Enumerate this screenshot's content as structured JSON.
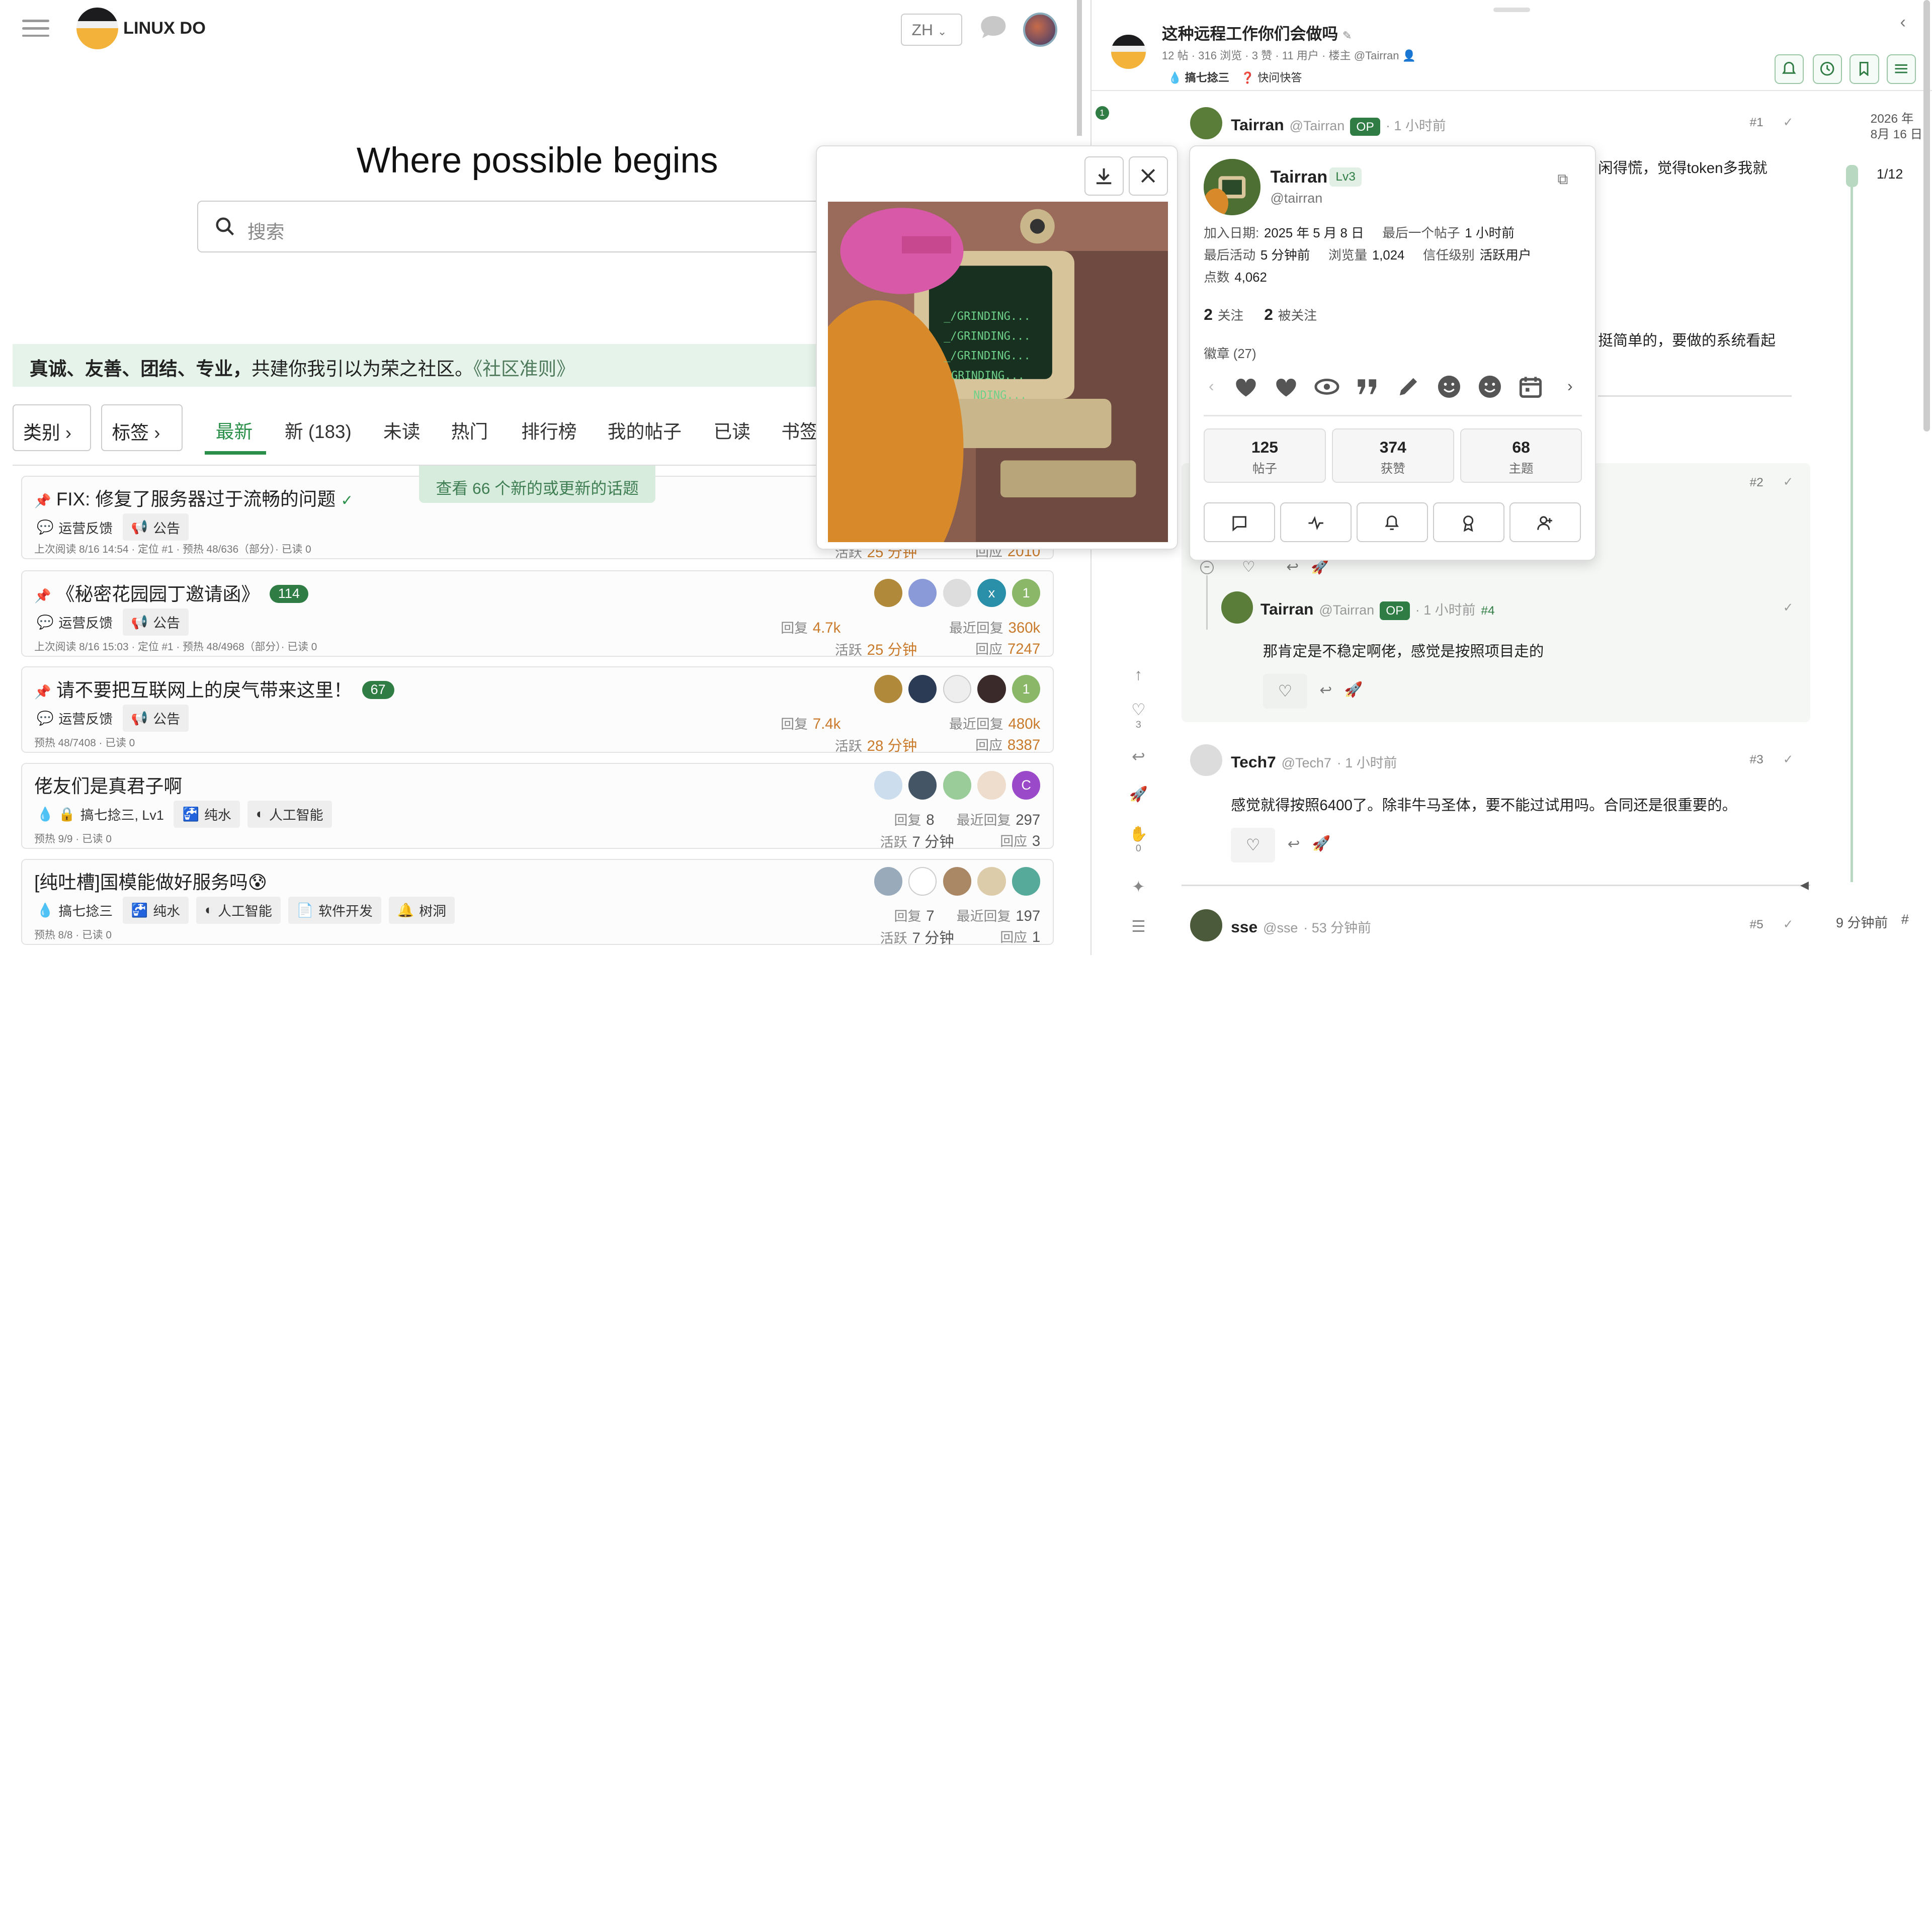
{
  "left": {
    "brand": "LINUX DO",
    "lang": "ZH",
    "hero": "Where possible begins",
    "search_placeholder": "搜索",
    "banner_bold": "真诚、友善、团结、专业，",
    "banner_text": "共建你我引以为荣之社区。",
    "banner_link": "《社区准则》",
    "dropdowns": [
      "类别",
      "标签"
    ],
    "nav": [
      "最新",
      "新 (183)",
      "未读",
      "热门",
      "排行榜",
      "我的帖子",
      "已读",
      "书签"
    ],
    "new_topics": "查看 66 个新的或更新的话题",
    "topics": [
      {
        "title": "FIX: 修复了服务器过于流畅的问题",
        "tags": [
          "运营反馈",
          "公告"
        ],
        "meta": "上次阅读 8/16 14:54 · 定位 #1 · 预热 48/636（部分）· 已读 0",
        "activity_label": "活跃",
        "activity": "25 分钟",
        "replies_label": "回应",
        "replies_total": "2010"
      },
      {
        "title": "《秘密花园园丁邀请函》",
        "count": "114",
        "tags": [
          "运营反馈",
          "公告"
        ],
        "meta": "上次阅读 8/16 15:03 · 定位 #1 · 预热 48/4968（部分）· 已读 0",
        "reply_label": "回复",
        "reply": "4.7k",
        "last_label": "最近回复",
        "last": "360k",
        "activity_label": "活跃",
        "activity": "25 分钟",
        "replies_label": "回应",
        "replies_total": "7247"
      },
      {
        "title": "请不要把互联网上的戾气带来这里！",
        "count": "67",
        "tags": [
          "运营反馈",
          "公告"
        ],
        "meta": "预热 48/7408 · 已读 0",
        "reply_label": "回复",
        "reply": "7.4k",
        "last_label": "最近回复",
        "last": "480k",
        "activity_label": "活跃",
        "activity": "28 分钟",
        "replies_label": "回应",
        "replies_total": "8387"
      },
      {
        "title": "佬友们是真君子啊",
        "tags": [
          "搞七捻三, Lv1",
          "纯水",
          "人工智能"
        ],
        "meta": "预热 9/9 · 已读 0",
        "reply_label": "回复",
        "reply": "8",
        "last_label": "最近回复",
        "last": "297",
        "activity_label": "活跃",
        "activity": "7 分钟",
        "replies_label": "回应",
        "replies_total": "3"
      },
      {
        "title": "[纯吐槽]国模能做好服务吗😰",
        "tags": [
          "搞七捻三",
          "纯水",
          "人工智能",
          "软件开发",
          "树洞"
        ],
        "meta": "预热 8/8 · 已读 0",
        "reply_label": "回复",
        "reply": "7",
        "last_label": "最近回复",
        "last": "197",
        "activity_label": "活跃",
        "activity": "7 分钟",
        "replies_label": "回应",
        "replies_total": "1"
      }
    ]
  },
  "right": {
    "title": "这种远程工作你们会做吗",
    "sub": "12 帖 · 316 浏览 · 3 赞 · 11 用户 · 楼主 @Tairran",
    "tags": [
      "搞七捻三",
      "快问快答"
    ],
    "side_date": [
      "2026 年",
      "8月 16 日"
    ],
    "timeline_count": "1/12",
    "timeline_ago": "9 分钟前",
    "unread_badge": "1",
    "posts": [
      {
        "name": "Tairran",
        "handle": "@Tairran",
        "op": "OP",
        "time": "· 1 小时前",
        "num": "#1",
        "body1": "闲得慌，觉得token多我就",
        "body2": "挺简单的，要做的系统看起"
      },
      {
        "num": "#2"
      },
      {
        "name": "Tairran",
        "handle": "@Tairran",
        "op": "OP",
        "time": "· 1 小时前",
        "num": "#4",
        "body": "那肯定是不稳定啊佬，感觉是按照项目走的"
      },
      {
        "name": "Tech7",
        "handle": "@Tech7",
        "time": "· 1 小时前",
        "num": "#3",
        "body": "感觉就得按照6400了。除非牛马圣体，要不能过试用吗。合同还是很重要的。"
      },
      {
        "name": "sse",
        "handle": "@sse",
        "time": "· 53 分钟前",
        "num": "#5"
      }
    ],
    "side_counts": {
      "likes": "3",
      "hand": "0"
    }
  },
  "user_card": {
    "name": "Tairran",
    "level": "Lv3",
    "handle": "@tairran",
    "joined_label": "加入日期:",
    "joined": "2025 年 5 月 8 日",
    "last_post_label": "最后一个帖子",
    "last_post": "1 小时前",
    "last_active_label": "最后活动",
    "last_active": "5 分钟前",
    "views_label": "浏览量",
    "views": "1,024",
    "trust_label": "信任级别",
    "trust": "活跃用户",
    "points_label": "点数",
    "points": "4,062",
    "following": "2",
    "following_label": "关注",
    "followers": "2",
    "followers_label": "被关注",
    "badges_label": "徽章 (27)",
    "stats": [
      {
        "n": "125",
        "l": "帖子"
      },
      {
        "n": "374",
        "l": "获赞"
      },
      {
        "n": "68",
        "l": "主题"
      }
    ]
  },
  "image_lines": [
    "_/GRINDING...",
    "_/GRINDING...",
    "_/GRINDING...",
    "GRINDING...",
    "NDING..."
  ],
  "colors": {
    "accent": "#2a8f48",
    "op_badge": "#2f7d44",
    "banner_bg": "#e5f3ea",
    "orange_stat": "#c97a2a"
  }
}
